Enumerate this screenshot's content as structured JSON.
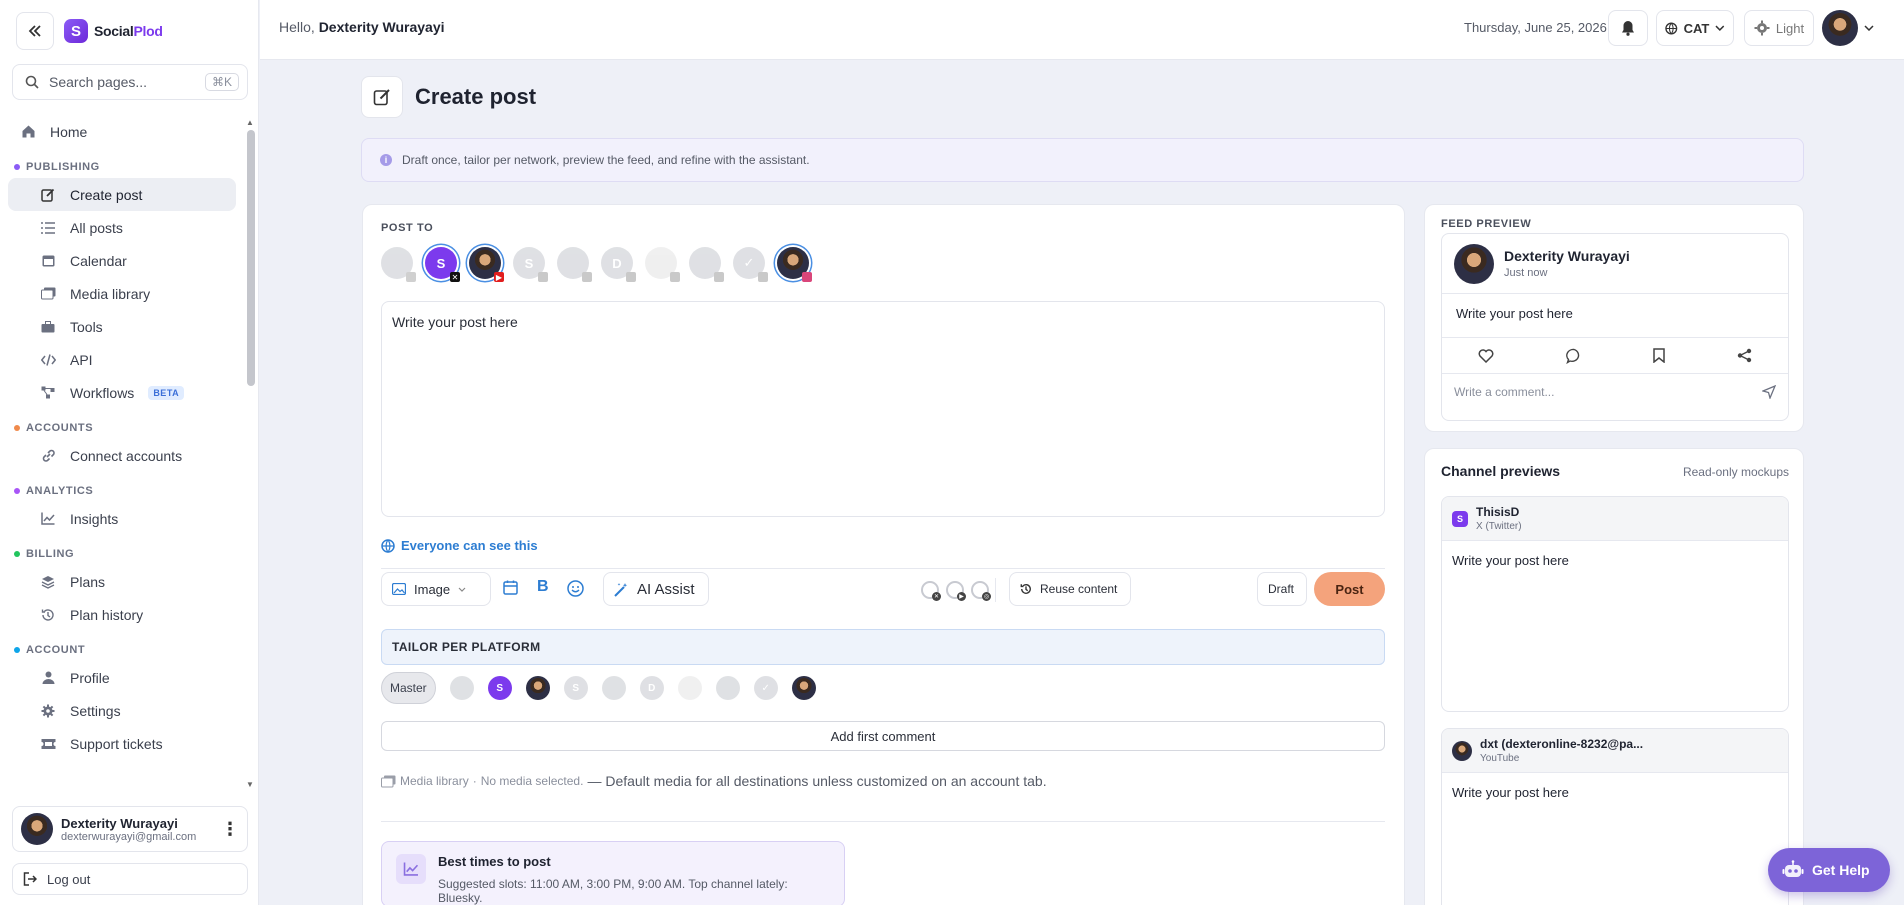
{
  "brand": {
    "name_main": "Social",
    "name_accent": "Plod",
    "logo_letter": "S"
  },
  "search": {
    "placeholder": "Search pages...",
    "shortcut": "⌘K"
  },
  "sidebar": {
    "home": "Home",
    "sections": [
      {
        "title": "PUBLISHING",
        "color": "#8b5cf6",
        "items": [
          "Create post",
          "All posts",
          "Calendar",
          "Media library",
          "Tools",
          "API",
          "Workflows"
        ]
      },
      {
        "title": "ACCOUNTS",
        "color": "#f08a4b",
        "items": [
          "Connect accounts"
        ]
      },
      {
        "title": "ANALYTICS",
        "color": "#a855f7",
        "items": [
          "Insights"
        ]
      },
      {
        "title": "BILLING",
        "color": "#22c55e",
        "items": [
          "Plans",
          "Plan history"
        ]
      },
      {
        "title": "ACCOUNT",
        "color": "#0ea5e9",
        "items": [
          "Profile",
          "Settings",
          "Support tickets"
        ]
      }
    ],
    "beta_badge": "BETA",
    "active_item": "Create post"
  },
  "user": {
    "name": "Dexterity Wurayayi",
    "email": "dexterwurayayi@gmail.com"
  },
  "logout": "Log out",
  "topbar": {
    "hello": "Hello,",
    "user_name": "Dexterity Wurayayi",
    "date": "Thursday, June 25, 2026",
    "language": "CAT",
    "theme": "Light"
  },
  "page": {
    "title": "Create post",
    "info": "Draft once, tailor per network, preview the feed, and refine with the assistant."
  },
  "composer": {
    "post_to_label": "POST TO",
    "placeholder": "Write your post here",
    "visibility": "Everyone can see this",
    "image_label": "Image",
    "ai_assist": "AI Assist",
    "reuse": "Reuse content",
    "draft": "Draft",
    "post": "Post",
    "tailor_label": "TAILOR PER PLATFORM",
    "master": "Master",
    "add_comment": "Add first comment",
    "media_library": "Media library",
    "media_separator": "·",
    "no_media": "No media selected.",
    "media_note": "— Default media for all destinations unless customized on an account tab.",
    "best_title": "Best times to post",
    "best_sub": "Suggested slots: 11:00 AM, 3:00 PM, 9:00 AM. Top channel lately: Bluesky."
  },
  "feed_preview": {
    "label": "FEED PREVIEW",
    "name": "Dexterity Wurayayi",
    "time": "Just now",
    "body": "Write your post here",
    "comment_placeholder": "Write a comment..."
  },
  "channels": {
    "title": "Channel previews",
    "note": "Read-only mockups",
    "cards": [
      {
        "name": "ThisisD",
        "network": "X (Twitter)",
        "body": "Write your post here"
      },
      {
        "name": "dxt (dexteronline-8232@pa...",
        "network": "YouTube",
        "body": "Write your post here"
      }
    ]
  },
  "get_help": "Get Help"
}
